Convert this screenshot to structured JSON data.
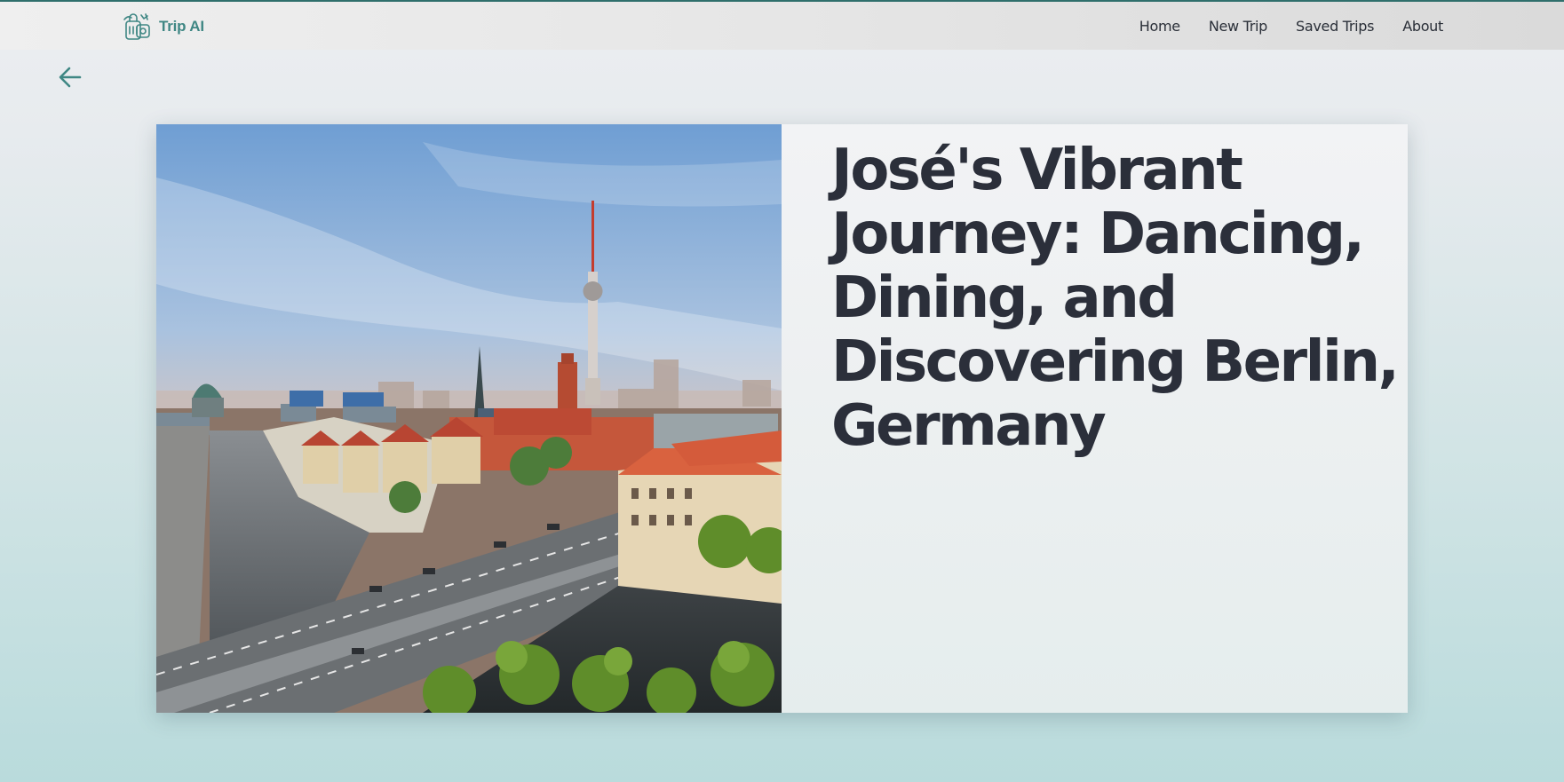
{
  "app": {
    "brand_name": "Trip AI",
    "accent_color": "#3f8784",
    "topline_color": "#2f6f6c"
  },
  "nav": {
    "items": [
      {
        "label": "Home"
      },
      {
        "label": "New Trip"
      },
      {
        "label": "Saved Trips"
      },
      {
        "label": "About"
      }
    ]
  },
  "icons": {
    "logo": "travel-bag-icon",
    "back": "arrow-left-icon"
  },
  "trip": {
    "title": "José's Vibrant Journey: Dancing, Dining, and Discovering Berlin, Germany",
    "image_subject": "berlin-skyline-photo"
  }
}
